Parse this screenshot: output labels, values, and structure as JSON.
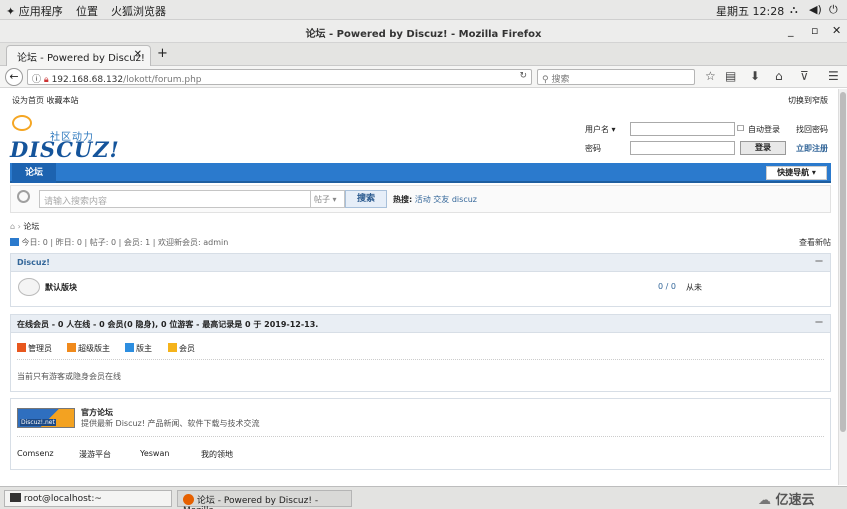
{
  "system": {
    "apps_menu": "应用程序",
    "places_menu": "位置",
    "browser_menu": "火狐浏览器",
    "clock": "星期五 12:28"
  },
  "window": {
    "title": "论坛 - Powered by Discuz! - Mozilla Firefox",
    "minimize": "_",
    "maximize": "▫",
    "close": "✕"
  },
  "tab": {
    "label": "论坛 - Powered by Discuz!",
    "close": "✕",
    "new": "+"
  },
  "toolbar": {
    "url_host": "192.168.68.132",
    "url_path": "/lokott/forum.php",
    "search_placeholder": "搜索"
  },
  "site": {
    "set_home": "设为首页",
    "bookmark": "收藏本站",
    "switch_style": "切换到窄版",
    "slogan": "社区动力",
    "logo_word": "DISCUZ!",
    "login": {
      "username_label": "用户名",
      "password_label": "密码",
      "auto_login": "自动登录",
      "forgot": "找回密码",
      "login_button": "登录",
      "register": "立即注册"
    },
    "nav_forum": "论坛",
    "quick_nav": "快捷导航",
    "search": {
      "placeholder": "请输入搜索内容",
      "type": "帖子",
      "button": "搜索",
      "hot_label": "热搜:",
      "hot": [
        "活动",
        "交友",
        "discuz"
      ]
    },
    "breadcrumb": "论坛",
    "stats": "今日: 0 | 昨日: 0 | 帖子: 0 | 会员: 1 | 欢迎新会员: admin",
    "new_posts": "查看新帖",
    "forum_box": {
      "title": "Discuz!",
      "forum_name": "默认版块",
      "counts": "0 / 0",
      "last": "从未"
    },
    "online_box": {
      "title": "在线会员 - 0 人在线 - 0 会员(0 隐身), 0 位游客 - 最高记录是 0 于 2019-12-13.",
      "groups": [
        "管理员",
        "超级版主",
        "版主",
        "会员"
      ],
      "note": "当前只有游客或隐身会员在线"
    },
    "links_box": {
      "official_title": "官方论坛",
      "official_desc": "提供最新 Discuz! 产品新闻、软件下载与技术交流",
      "logo_text": "Discuz!.net",
      "friends": [
        "Comsenz",
        "漫游平台",
        "Yeswan",
        "我的领地"
      ]
    }
  },
  "taskbar": {
    "terminal": "root@localhost:~",
    "firefox": "论坛 - Powered by Discuz! - Mozilla ...",
    "watermark": "亿速云"
  },
  "colors": {
    "nav_blue": "#2b7acd",
    "admin_icon": "#e8571e",
    "smod_icon": "#f08a1c",
    "mod_icon": "#2d8ee0",
    "member_icon": "#f5b31b"
  }
}
